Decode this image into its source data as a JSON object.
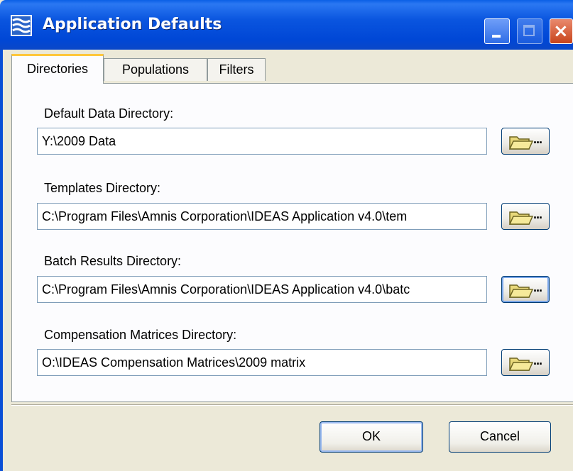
{
  "window": {
    "title": "Application Defaults",
    "icon": "app-waves-icon",
    "controls": {
      "minimize": "minimize-icon",
      "maximize": "maximize-icon",
      "close": "×"
    }
  },
  "tabs": [
    {
      "label": "Directories",
      "active": true
    },
    {
      "label": "Populations",
      "active": false
    },
    {
      "label": "Filters",
      "active": false
    }
  ],
  "fields": [
    {
      "label": "Default Data Directory:",
      "value": "Y:\\2009 Data",
      "browse_label": "..."
    },
    {
      "label": "Templates Directory:",
      "value": "C:\\Program Files\\Amnis Corporation\\IDEAS Application v4.0\\tem",
      "browse_label": "..."
    },
    {
      "label": "Batch Results Directory:",
      "value": "C:\\Program Files\\Amnis Corporation\\IDEAS Application v4.0\\batc",
      "browse_label": "..."
    },
    {
      "label": "Compensation Matrices Directory:",
      "value": "O:\\IDEAS Compensation Matrices\\2009 matrix",
      "browse_label": "..."
    }
  ],
  "buttons": {
    "ok": "OK",
    "cancel": "Cancel"
  },
  "colors": {
    "titlebar": "#0a55df",
    "dialog_bg": "#ece9d8",
    "active_tab_accent": "#ffc73c",
    "close_button": "#c8441b"
  }
}
